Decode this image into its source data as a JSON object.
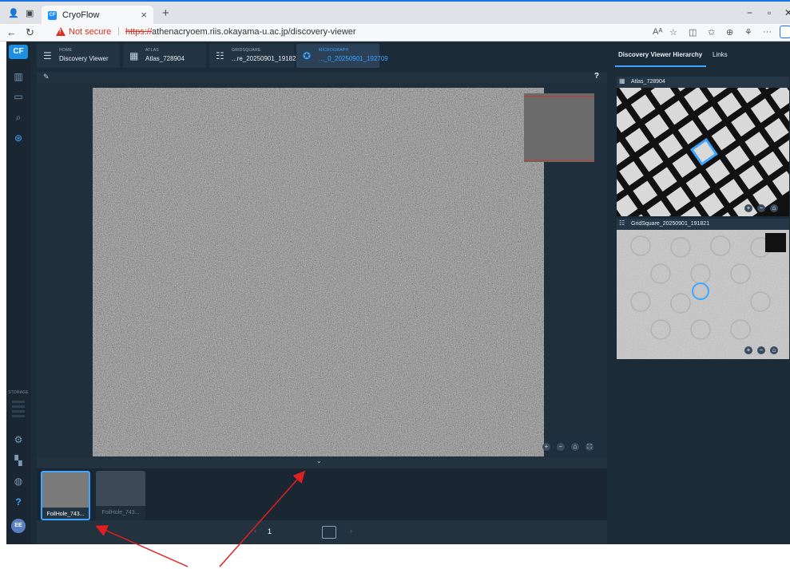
{
  "browser": {
    "tab_title": "CryoFlow",
    "tab_favicon": "CF",
    "not_secure": "Not secure",
    "url_scheme": "https://",
    "url_rest": "athenacryoem.riis.okayama-u.ac.jp/discovery-viewer",
    "new_tab_glyph": "+",
    "close_glyph": "×",
    "more_glyph": "···"
  },
  "app": {
    "logo": "CF",
    "storage_label": "STORAGE",
    "avatar_initials": "EE",
    "help_glyph": "?",
    "breadcrumbs": [
      {
        "kicker": "HOME",
        "text": "Discovery Viewer",
        "icon": "menu-icon"
      },
      {
        "kicker": "ATLAS",
        "text": "Atlas_728904",
        "icon": "grid-icon"
      },
      {
        "kicker": "GRIDSQUARE",
        "text": "...re_20250901_191821",
        "icon": "list-icon"
      },
      {
        "kicker": "MICROGRAPH",
        "text": "..._0_20250901_192709",
        "icon": "micrograph-icon"
      }
    ],
    "thumbnails": [
      {
        "label": "FoilHole_743...",
        "selected": true
      },
      {
        "label": "FoilHole_743...",
        "selected": false
      }
    ],
    "pager": {
      "current": "1"
    },
    "right_tabs": {
      "hierarchy": "Discovery Viewer Hierarchy",
      "links": "Links"
    },
    "hierarchy": {
      "atlas_title": "Atlas_728904",
      "gridsquare_title": "GridSquare_20250901_191821"
    }
  },
  "colors": {
    "accent": "#3ea6ff",
    "app_bg": "#1c2b38",
    "annotation_arrow": "#e02020"
  }
}
